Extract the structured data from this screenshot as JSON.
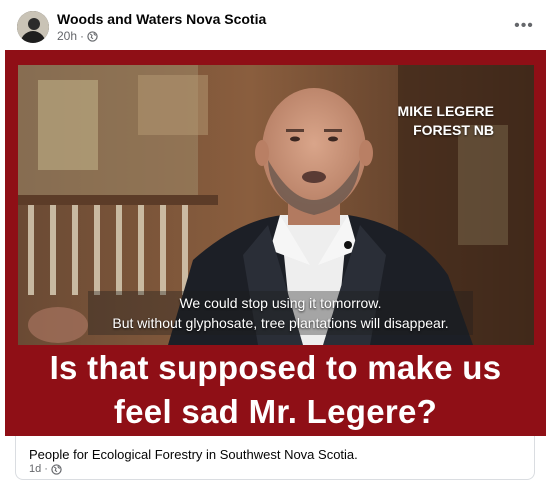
{
  "post": {
    "page_name": "Woods and Waters Nova Scotia",
    "time": "20h",
    "separator": "·",
    "privacy_icon": "globe-icon",
    "more_icon": "more-horizontal-icon",
    "more_label": "•••"
  },
  "media": {
    "name_tag_line1": "MIKE LEGERE",
    "name_tag_line2": "FOREST NB",
    "subtitle_line1": "We could stop using it tomorrow.",
    "subtitle_line2": "But without glyphosate, tree plantations will disappear.",
    "headline_line1": "Is that supposed to make us",
    "headline_line2": "feel sad Mr. Legere?",
    "frame_color": "#8f0f16"
  },
  "shared_post": {
    "title": "People for Ecological Forestry in Southwest Nova Scotia.",
    "time": "1d",
    "separator": "·",
    "privacy_icon": "globe-icon"
  }
}
